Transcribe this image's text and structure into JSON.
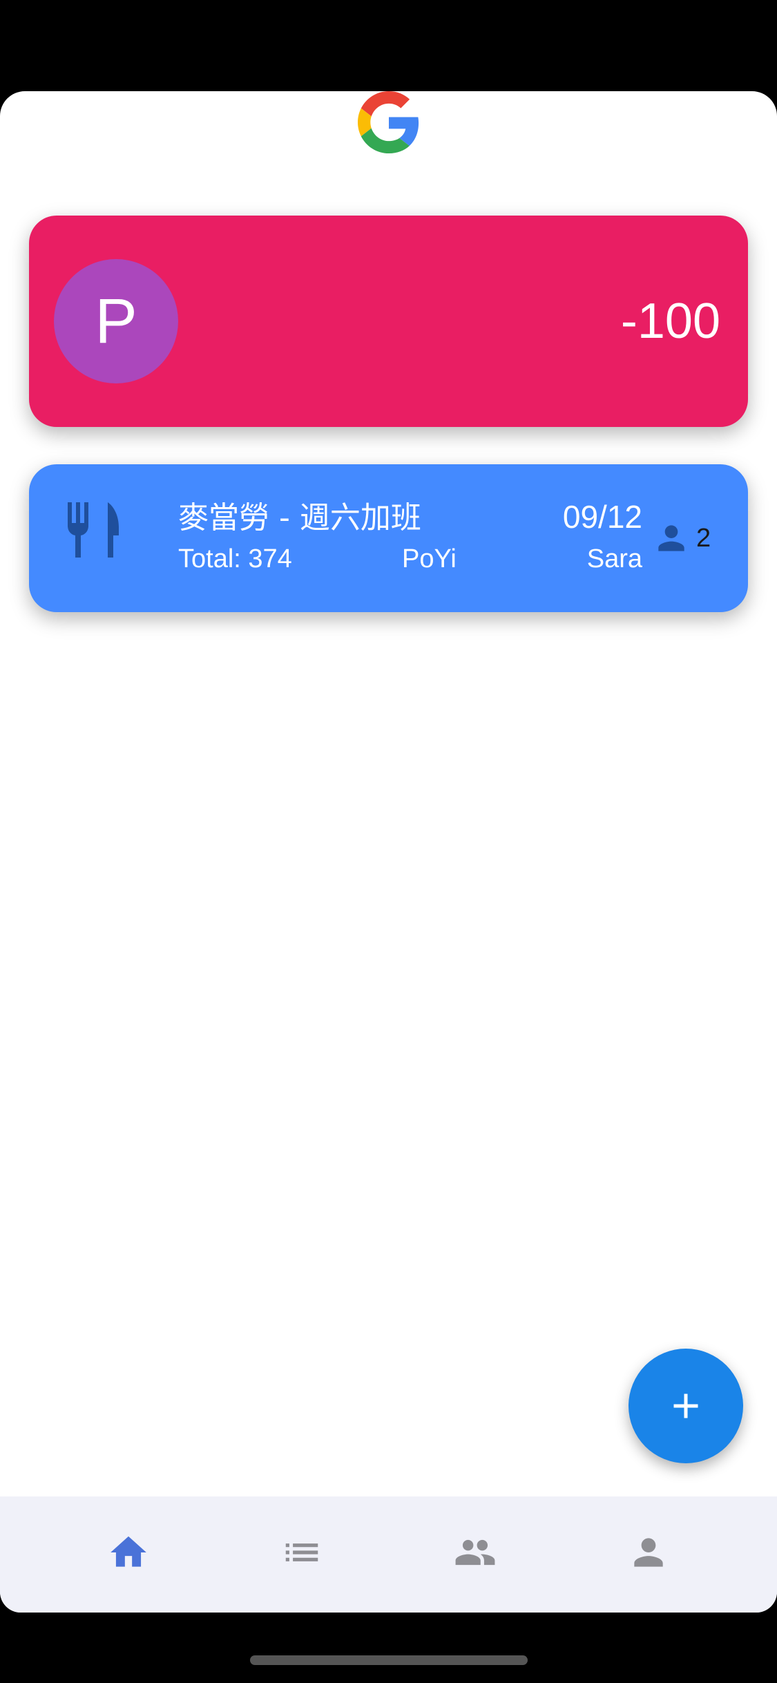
{
  "colors": {
    "balance_card": "#e91e63",
    "avatar": "#ab47bc",
    "expense_card": "#448aff",
    "icon_dark": "#1f4f9c",
    "fab": "#1a84e8",
    "nav_active": "#4a72d8",
    "nav_inactive": "#8e8e93"
  },
  "header": {
    "logo_icon": "google-g-logo"
  },
  "balance": {
    "avatar_initial": "P",
    "amount": "-100"
  },
  "expense": {
    "category_icon": "fork-knife-icon",
    "title": "麥當勞 - 週六加班",
    "date": "09/12",
    "total": "Total: 374",
    "payer": "PoYi",
    "participant": "Sara",
    "participants_icon": "person-icon",
    "participants_count": "2"
  },
  "fab": {
    "icon": "plus-icon"
  },
  "nav": {
    "items": [
      {
        "icon": "home-icon",
        "active": true
      },
      {
        "icon": "list-icon",
        "active": false
      },
      {
        "icon": "group-icon",
        "active": false
      },
      {
        "icon": "person-icon",
        "active": false
      }
    ]
  }
}
